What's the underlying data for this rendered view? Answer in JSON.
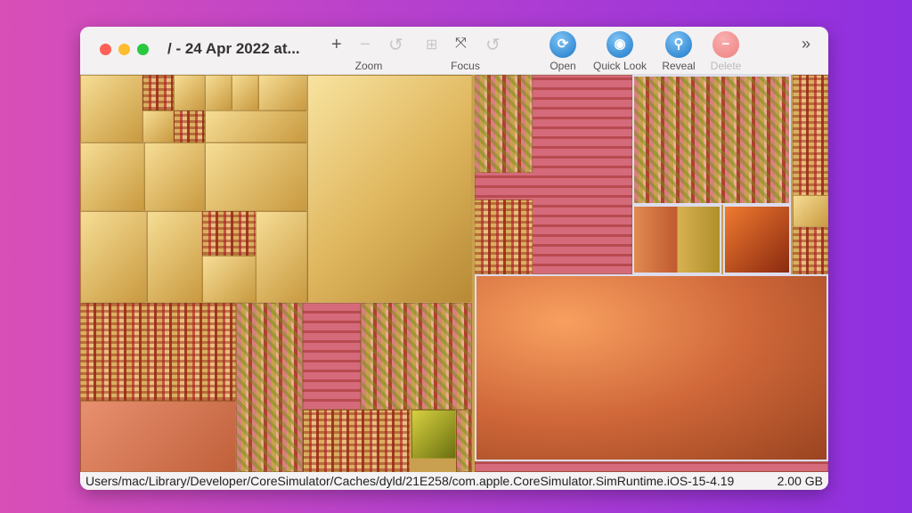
{
  "window": {
    "title": "/ - 24 Apr 2022 at..."
  },
  "toolbar": {
    "zoom_in": "+",
    "zoom_out": "−",
    "zoom_label": "Zoom",
    "focus_label": "Focus",
    "open_label": "Open",
    "quicklook_label": "Quick Look",
    "reveal_label": "Reveal",
    "delete_label": "Delete",
    "overflow": "»"
  },
  "status": {
    "path": "Users/mac/Library/Developer/CoreSimulator/Caches/dyld/21E258/com.apple.CoreSimulator.SimRuntime.iOS-15-4.19",
    "size": "2.00 GB"
  },
  "colors": {
    "close": "#fe5f57",
    "minimize": "#febc2e",
    "maximize": "#28c840",
    "accent": "#1c78c8",
    "delete": "#f08080"
  }
}
